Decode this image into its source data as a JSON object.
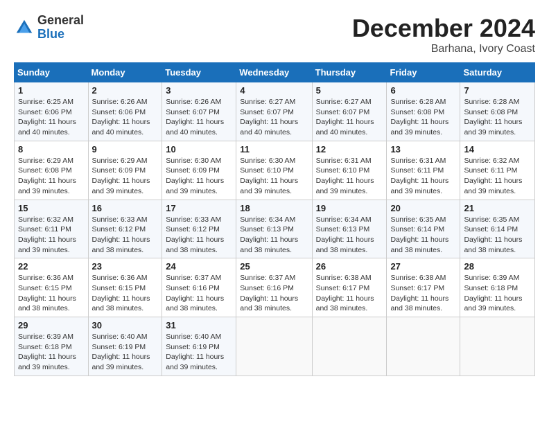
{
  "header": {
    "logo": {
      "general": "General",
      "blue": "Blue"
    },
    "title": "December 2024",
    "location": "Barhana, Ivory Coast"
  },
  "days_of_week": [
    "Sunday",
    "Monday",
    "Tuesday",
    "Wednesday",
    "Thursday",
    "Friday",
    "Saturday"
  ],
  "weeks": [
    [
      {
        "day": "1",
        "sunrise": "6:25 AM",
        "sunset": "6:06 PM",
        "daylight": "11 hours and 40 minutes."
      },
      {
        "day": "2",
        "sunrise": "6:26 AM",
        "sunset": "6:06 PM",
        "daylight": "11 hours and 40 minutes."
      },
      {
        "day": "3",
        "sunrise": "6:26 AM",
        "sunset": "6:07 PM",
        "daylight": "11 hours and 40 minutes."
      },
      {
        "day": "4",
        "sunrise": "6:27 AM",
        "sunset": "6:07 PM",
        "daylight": "11 hours and 40 minutes."
      },
      {
        "day": "5",
        "sunrise": "6:27 AM",
        "sunset": "6:07 PM",
        "daylight": "11 hours and 40 minutes."
      },
      {
        "day": "6",
        "sunrise": "6:28 AM",
        "sunset": "6:08 PM",
        "daylight": "11 hours and 39 minutes."
      },
      {
        "day": "7",
        "sunrise": "6:28 AM",
        "sunset": "6:08 PM",
        "daylight": "11 hours and 39 minutes."
      }
    ],
    [
      {
        "day": "8",
        "sunrise": "6:29 AM",
        "sunset": "6:08 PM",
        "daylight": "11 hours and 39 minutes."
      },
      {
        "day": "9",
        "sunrise": "6:29 AM",
        "sunset": "6:09 PM",
        "daylight": "11 hours and 39 minutes."
      },
      {
        "day": "10",
        "sunrise": "6:30 AM",
        "sunset": "6:09 PM",
        "daylight": "11 hours and 39 minutes."
      },
      {
        "day": "11",
        "sunrise": "6:30 AM",
        "sunset": "6:10 PM",
        "daylight": "11 hours and 39 minutes."
      },
      {
        "day": "12",
        "sunrise": "6:31 AM",
        "sunset": "6:10 PM",
        "daylight": "11 hours and 39 minutes."
      },
      {
        "day": "13",
        "sunrise": "6:31 AM",
        "sunset": "6:11 PM",
        "daylight": "11 hours and 39 minutes."
      },
      {
        "day": "14",
        "sunrise": "6:32 AM",
        "sunset": "6:11 PM",
        "daylight": "11 hours and 39 minutes."
      }
    ],
    [
      {
        "day": "15",
        "sunrise": "6:32 AM",
        "sunset": "6:11 PM",
        "daylight": "11 hours and 39 minutes."
      },
      {
        "day": "16",
        "sunrise": "6:33 AM",
        "sunset": "6:12 PM",
        "daylight": "11 hours and 38 minutes."
      },
      {
        "day": "17",
        "sunrise": "6:33 AM",
        "sunset": "6:12 PM",
        "daylight": "11 hours and 38 minutes."
      },
      {
        "day": "18",
        "sunrise": "6:34 AM",
        "sunset": "6:13 PM",
        "daylight": "11 hours and 38 minutes."
      },
      {
        "day": "19",
        "sunrise": "6:34 AM",
        "sunset": "6:13 PM",
        "daylight": "11 hours and 38 minutes."
      },
      {
        "day": "20",
        "sunrise": "6:35 AM",
        "sunset": "6:14 PM",
        "daylight": "11 hours and 38 minutes."
      },
      {
        "day": "21",
        "sunrise": "6:35 AM",
        "sunset": "6:14 PM",
        "daylight": "11 hours and 38 minutes."
      }
    ],
    [
      {
        "day": "22",
        "sunrise": "6:36 AM",
        "sunset": "6:15 PM",
        "daylight": "11 hours and 38 minutes."
      },
      {
        "day": "23",
        "sunrise": "6:36 AM",
        "sunset": "6:15 PM",
        "daylight": "11 hours and 38 minutes."
      },
      {
        "day": "24",
        "sunrise": "6:37 AM",
        "sunset": "6:16 PM",
        "daylight": "11 hours and 38 minutes."
      },
      {
        "day": "25",
        "sunrise": "6:37 AM",
        "sunset": "6:16 PM",
        "daylight": "11 hours and 38 minutes."
      },
      {
        "day": "26",
        "sunrise": "6:38 AM",
        "sunset": "6:17 PM",
        "daylight": "11 hours and 38 minutes."
      },
      {
        "day": "27",
        "sunrise": "6:38 AM",
        "sunset": "6:17 PM",
        "daylight": "11 hours and 38 minutes."
      },
      {
        "day": "28",
        "sunrise": "6:39 AM",
        "sunset": "6:18 PM",
        "daylight": "11 hours and 39 minutes."
      }
    ],
    [
      {
        "day": "29",
        "sunrise": "6:39 AM",
        "sunset": "6:18 PM",
        "daylight": "11 hours and 39 minutes."
      },
      {
        "day": "30",
        "sunrise": "6:40 AM",
        "sunset": "6:19 PM",
        "daylight": "11 hours and 39 minutes."
      },
      {
        "day": "31",
        "sunrise": "6:40 AM",
        "sunset": "6:19 PM",
        "daylight": "11 hours and 39 minutes."
      },
      null,
      null,
      null,
      null
    ]
  ],
  "labels": {
    "sunrise_prefix": "Sunrise: ",
    "sunset_prefix": "Sunset: ",
    "daylight_prefix": "Daylight: "
  }
}
